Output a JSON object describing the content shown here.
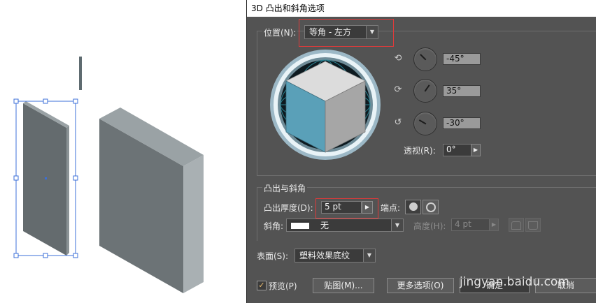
{
  "dialog": {
    "title": "3D 凸出和斜角选项",
    "position_label": "位置(N):",
    "position_value": "等角 - 左方",
    "rotation": {
      "x_value": "-45°",
      "y_value": "35°",
      "z_value": "-30°"
    },
    "perspective_label": "透视(R):",
    "perspective_value": "0°",
    "extrude_section_label": "凸出与斜角",
    "extrude_depth_label": "凸出厚度(D):",
    "extrude_depth_value": "5 pt",
    "cap_label": "端点:",
    "bevel_label": "斜角:",
    "bevel_value": "无",
    "height_label": "高度(H):",
    "height_value": "4 pt",
    "surface_label": "表面(S):",
    "surface_value": "塑料效果底纹",
    "preview_label": "预览(P)",
    "preview_checked": true,
    "map_button": "贴图(M)...",
    "more_options_button": "更多选项(O)",
    "ok_button": "确定",
    "cancel_button": "取消"
  },
  "watermark": "jingyan.baidu.com",
  "icons": {
    "x_axis": "x-axis-rotate-icon",
    "y_axis": "y-axis-rotate-icon",
    "z_axis": "z-axis-rotate-icon",
    "cap_on": "cap-on-icon",
    "cap_off": "cap-off-icon",
    "bevel_out": "bevel-out-icon",
    "bevel_in": "bevel-in-icon"
  },
  "colors": {
    "dialog_bg": "#535353",
    "highlight": "#e03a3a",
    "cube_left": "#5aa0b8",
    "cube_top": "#dcdcdc",
    "cube_right": "#a6a6a6",
    "selection": "#3b6fd8"
  }
}
